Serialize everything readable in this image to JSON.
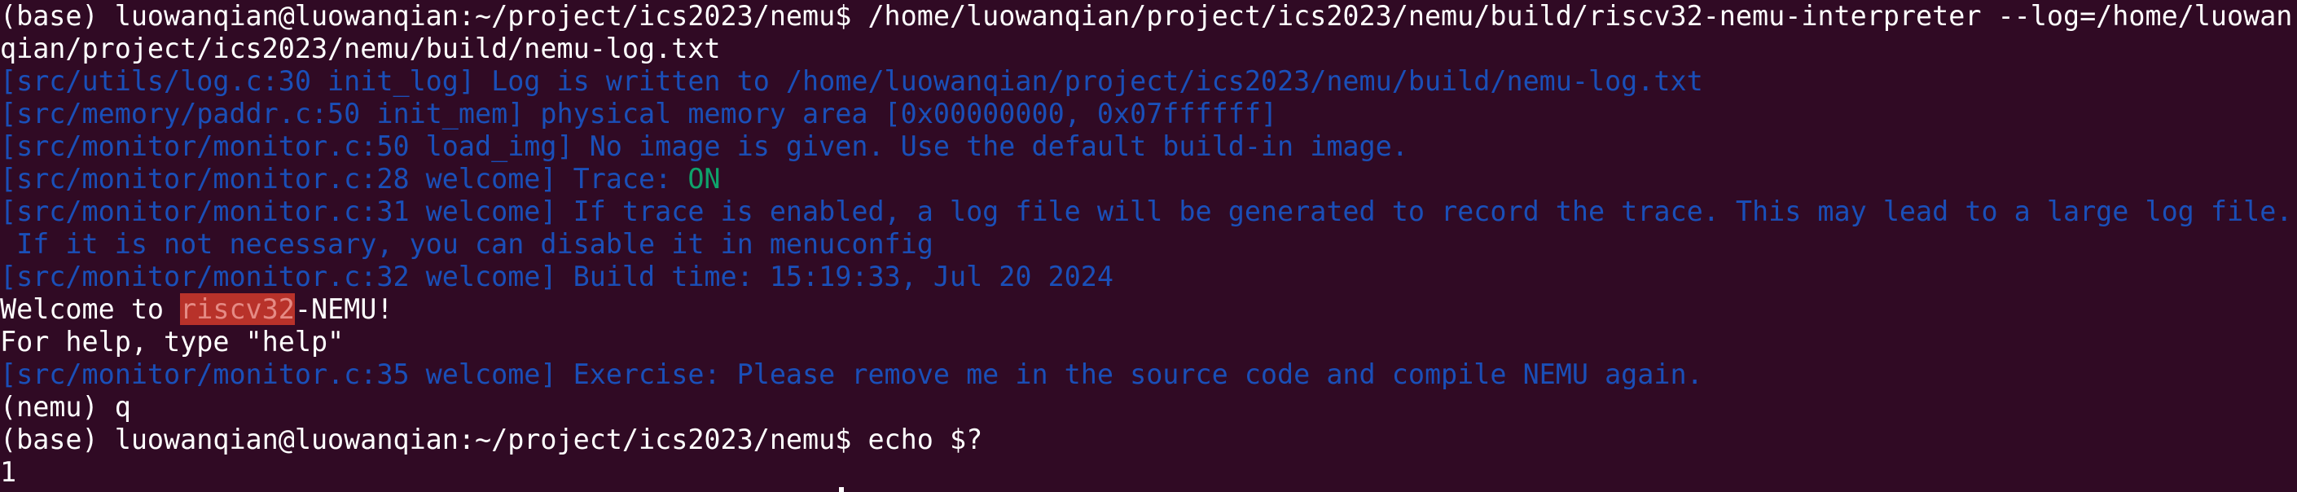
{
  "terminal": {
    "lines": [
      {
        "text": "(base) luowanqian@luowanqian:~/project/ics2023/nemu$ /home/luowanqian/project/ics2023/nemu/build/riscv32-nemu-interpreter --log=/home/luowan"
      },
      {
        "text": "qian/project/ics2023/nemu/build/nemu-log.txt"
      },
      {
        "text": "[src/utils/log.c:30 init_log] Log is written to /home/luowanqian/project/ics2023/nemu/build/nemu-log.txt"
      },
      {
        "text": "[src/memory/paddr.c:50 init_mem] physical memory area [0x00000000, 0x07ffffff]"
      },
      {
        "text": "[src/monitor/monitor.c:50 load_img] No image is given. Use the default build-in image."
      },
      {
        "prefix": "[src/monitor/monitor.c:28 welcome] Trace: ",
        "status": "ON"
      },
      {
        "text": "[src/monitor/monitor.c:31 welcome] If trace is enabled, a log file will be generated to record the trace. This may lead to a large log file."
      },
      {
        "text": " If it is not necessary, you can disable it in menuconfig"
      },
      {
        "text": "[src/monitor/monitor.c:32 welcome] Build time: 15:19:33, Jul 20 2024"
      },
      {
        "before": "Welcome to ",
        "highlight": "riscv32",
        "after": "-NEMU!"
      },
      {
        "text": "For help, type \"help\""
      },
      {
        "text": "[src/monitor/monitor.c:35 welcome] Exercise: Please remove me in the source code and compile NEMU again."
      },
      {
        "text": "(nemu) q"
      },
      {
        "text": "(base) luowanqian@luowanqian:~/project/ics2023/nemu$ echo $?"
      },
      {
        "text": "1"
      }
    ]
  },
  "colors": {
    "background": "#300a24",
    "default_text": "#ffffff",
    "log_text": "#1a4fb8",
    "status_on": "#0fa36b",
    "highlight_bg": "#b8322a",
    "highlight_text": "#e58a84"
  }
}
